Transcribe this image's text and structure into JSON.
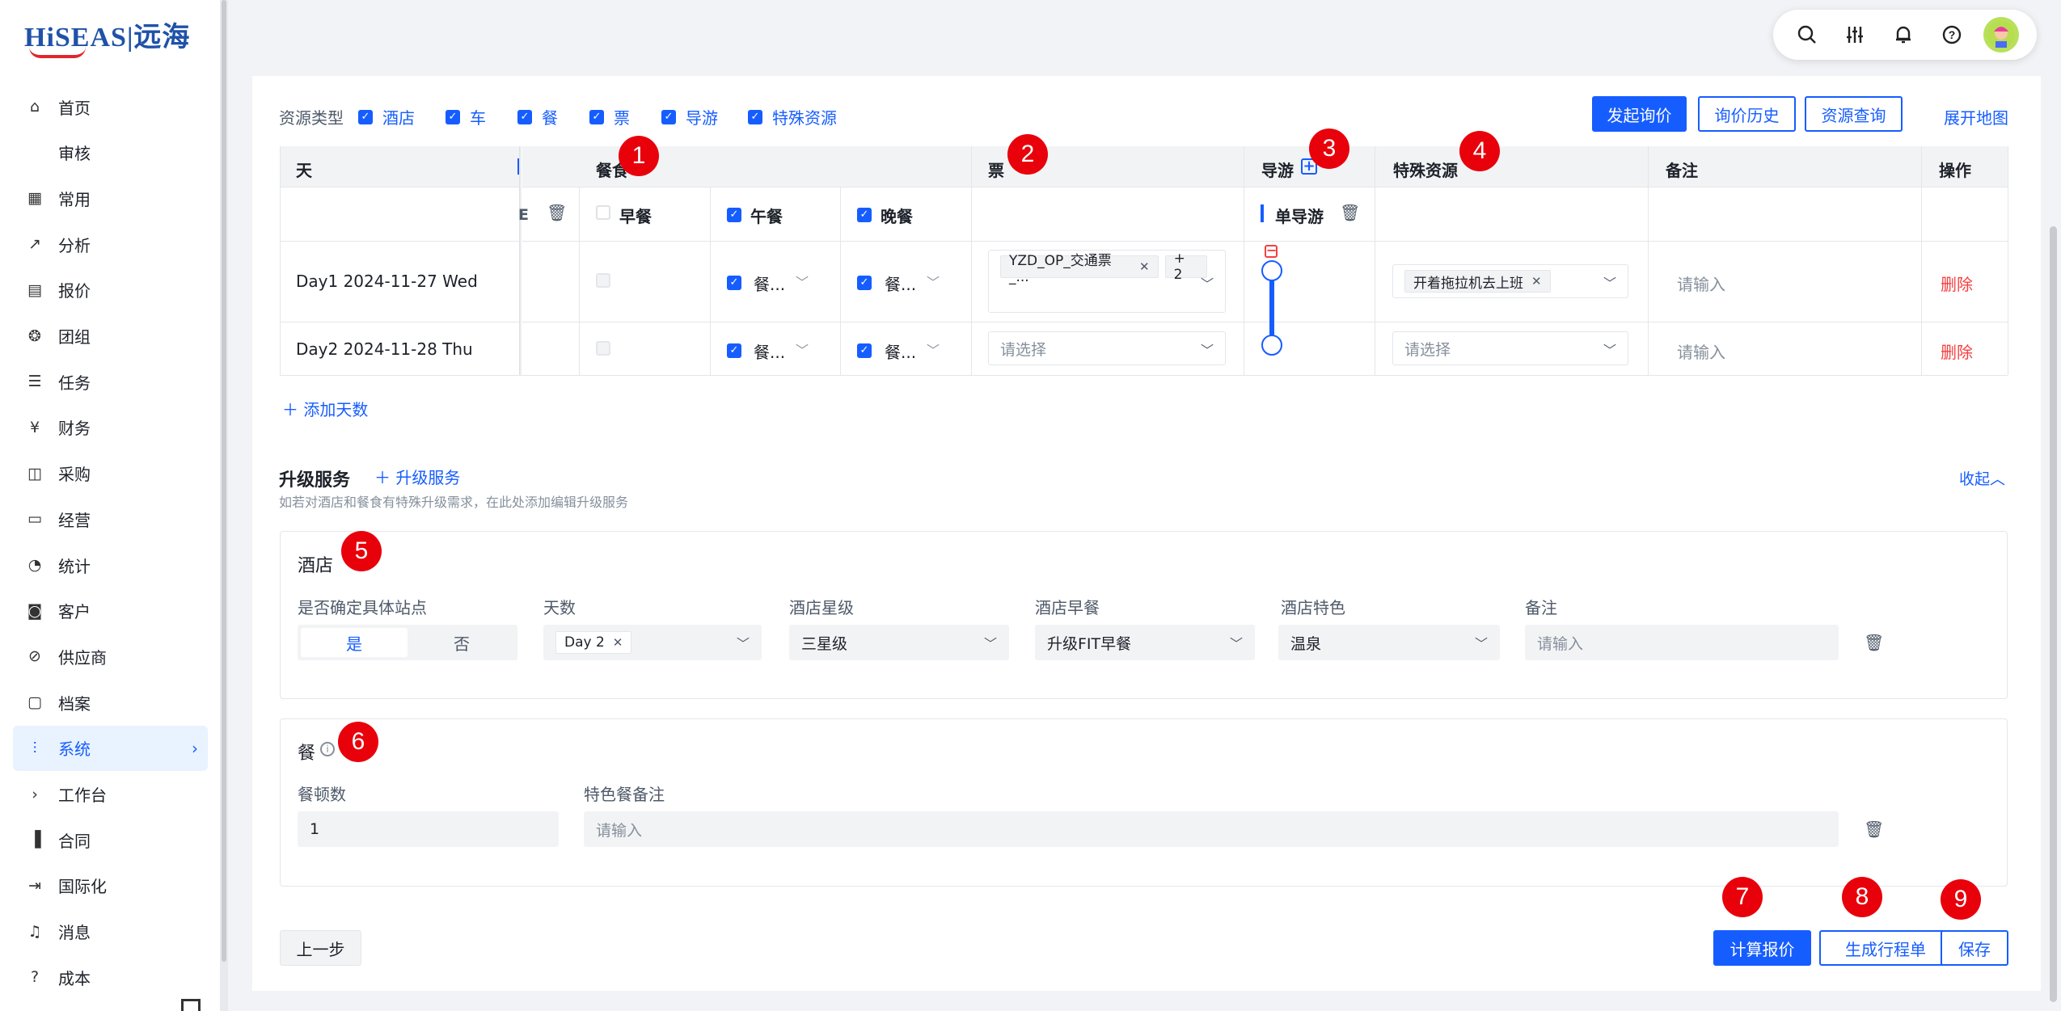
{
  "brand": {
    "logo_text": "HiSEAS|远海"
  },
  "sidebar": {
    "items": [
      {
        "label": "首页",
        "icon": "home-icon"
      },
      {
        "label": "审核",
        "icon": ""
      },
      {
        "label": "常用",
        "icon": "grid-icon"
      },
      {
        "label": "分析",
        "icon": "trend-icon"
      },
      {
        "label": "报价",
        "icon": "doc-icon"
      },
      {
        "label": "团组",
        "icon": "group-icon"
      },
      {
        "label": "任务",
        "icon": "task-icon"
      },
      {
        "label": "财务",
        "icon": "yen-icon"
      },
      {
        "label": "采购",
        "icon": "bag-icon"
      },
      {
        "label": "经营",
        "icon": "chart-icon"
      },
      {
        "label": "统计",
        "icon": "pie-icon"
      },
      {
        "label": "客户",
        "icon": "customer-icon"
      },
      {
        "label": "供应商",
        "icon": "supplier-icon"
      },
      {
        "label": "档案",
        "icon": "folder-icon"
      },
      {
        "label": "系统",
        "icon": "sliders-icon"
      },
      {
        "label": "工作台",
        "icon": "chevron-right-icon"
      },
      {
        "label": "合同",
        "icon": "contract-icon"
      },
      {
        "label": "国际化",
        "icon": "logout-icon"
      },
      {
        "label": "消息",
        "icon": "bell-icon"
      },
      {
        "label": "成本",
        "icon": "question-icon"
      }
    ],
    "active_index": 14
  },
  "topbar": {
    "icons": [
      "search-icon",
      "sliders-icon",
      "bell-icon",
      "help-icon",
      "user-avatar"
    ]
  },
  "resource_types": {
    "label": "资源类型",
    "items": [
      "酒店",
      "车",
      "餐",
      "票",
      "导游",
      "特殊资源"
    ]
  },
  "actions": {
    "inquiry": "发起询价",
    "history": "询价历史",
    "resource_query": "资源查询",
    "map": "展开地图"
  },
  "table": {
    "headers": {
      "day": "天",
      "meal": "餐食",
      "ticket": "票",
      "guide": "导游",
      "special": "特殊资源",
      "remark": "备注",
      "op": "操作"
    },
    "meal_sub": {
      "breakfast": "早餐",
      "lunch": "午餐",
      "dinner": "晚餐"
    },
    "guide_sub": "单导游",
    "rows": [
      {
        "day": "Day1 2024-11-27 Wed",
        "lunch": "餐...",
        "dinner": "餐...",
        "ticket_tag": "YZD_OP_交通票_...",
        "ticket_more": "+ 2",
        "special_tag": "开着拖拉机去上班",
        "remark_ph": "请输入",
        "delete": "删除"
      },
      {
        "day": "Day2 2024-11-28 Thu",
        "lunch": "餐...",
        "dinner": "餐...",
        "ticket_ph": "请选择",
        "special_ph": "请选择",
        "remark_ph": "请输入",
        "delete": "删除"
      }
    ],
    "add_day": "添加天数",
    "col_cut_mark": "E"
  },
  "upgrade": {
    "title": "升级服务",
    "add": "升级服务",
    "desc": "如若对酒店和餐食有特殊升级需求，在此处添加编辑升级服务",
    "collapse": "收起"
  },
  "hotel": {
    "title": "酒店",
    "fields": {
      "site": "是否确定具体站点",
      "days": "天数",
      "star": "酒店星级",
      "breakfast": "酒店早餐",
      "feature": "酒店特色",
      "remark": "备注"
    },
    "site_yes": "是",
    "site_no": "否",
    "days_tag": "Day 2",
    "star_val": "三星级",
    "breakfast_val": "升级FIT早餐",
    "feature_val": "温泉",
    "remark_ph": "请输入"
  },
  "meal": {
    "title": "餐",
    "fields": {
      "count": "餐顿数",
      "remark": "特色餐备注"
    },
    "count_val": "1",
    "remark_ph": "请输入"
  },
  "footer": {
    "prev": "上一步",
    "calc": "计算报价",
    "itinerary": "生成行程单",
    "save": "保存"
  },
  "markers": [
    "1",
    "2",
    "3",
    "4",
    "5",
    "6",
    "7",
    "8",
    "9"
  ],
  "colors": {
    "primary": "#165dff",
    "danger": "#f53f3f",
    "marker": "#e8000b",
    "active_bg": "#e8f3ff"
  }
}
